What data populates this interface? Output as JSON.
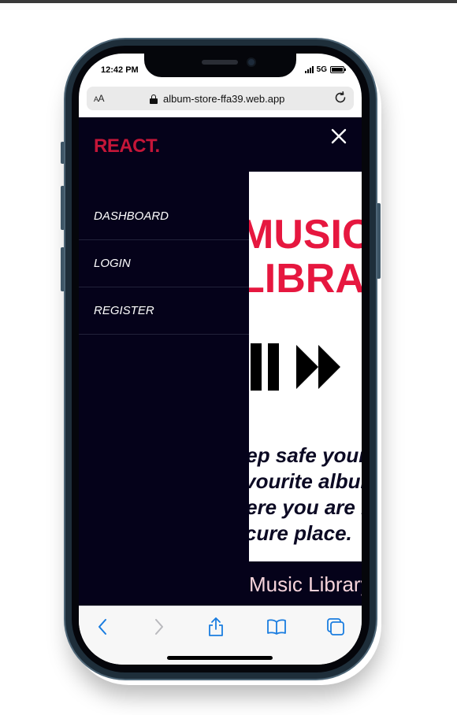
{
  "status_bar": {
    "time": "12:42 PM",
    "network": "5G"
  },
  "browser": {
    "text_size_label": "A",
    "text_size_label_small": "A",
    "url": "album-store-ffa39.web.app"
  },
  "app": {
    "brand": "REACT.",
    "nav": [
      {
        "label": "DASHBOARD"
      },
      {
        "label": "LOGIN"
      },
      {
        "label": "REGISTER"
      }
    ],
    "hero_title": "MUSIC\nLIBRARY",
    "hero_subtitle": "Keep safe your\nfavourite albums\nwhere you are in a\nsecure place.",
    "footer_text": "Music Library"
  },
  "colors": {
    "accent": "#e6173f",
    "brand": "#c41638",
    "background": "#05021a",
    "ios_blue": "#1a7de0"
  },
  "icons": [
    "close-icon",
    "lock-icon",
    "reload-icon",
    "back-icon",
    "forward-icon",
    "share-icon",
    "bookmarks-icon",
    "tabs-icon",
    "pause-icon",
    "fast-forward-icon"
  ]
}
